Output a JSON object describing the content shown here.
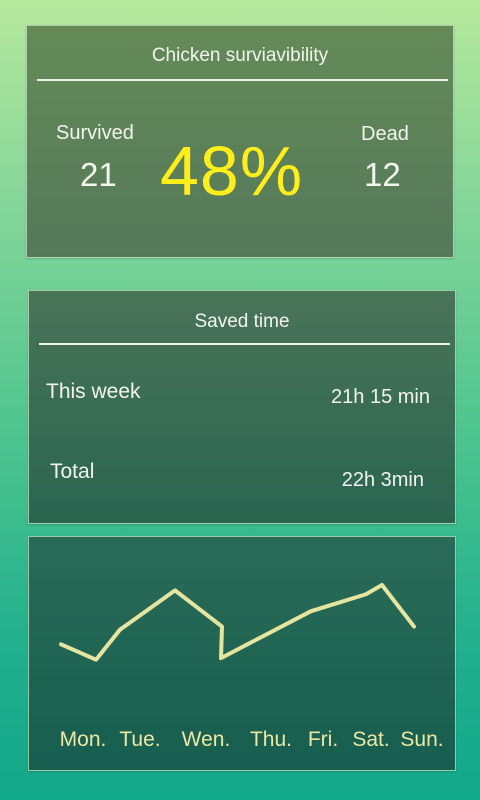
{
  "survivability": {
    "title": "Chicken surviavibility",
    "survived_label": "Survived",
    "survived_value": "21",
    "percent": "48%",
    "dead_label": "Dead",
    "dead_value": "12"
  },
  "saved_time": {
    "title": "Saved time",
    "rows": [
      {
        "label": "This week",
        "value": "21h 15 min"
      },
      {
        "label": "Total",
        "value": "22h 3min"
      }
    ]
  },
  "colors": {
    "percent": "#ffee1a",
    "line": "#e6e5a0",
    "day_labels": "#ece7a4"
  },
  "chart_data": {
    "type": "line",
    "categories": [
      "Mon.",
      "Tue.",
      "Wen.",
      "Thu.",
      "Fri.",
      "Sat.",
      "Sun."
    ],
    "points": [
      {
        "x": "Mon.",
        "y": 0.23
      },
      {
        "x": "Mon.",
        "y": 0.03
      },
      {
        "x": "Tue.",
        "y": 0.42
      },
      {
        "x": "Wen.",
        "y": 0.93
      },
      {
        "x": "Wen.",
        "y": 0.46
      },
      {
        "x": "Thu.",
        "y": 0.05
      },
      {
        "x": "Fri.",
        "y": 0.66
      },
      {
        "x": "Sat.",
        "y": 0.88
      },
      {
        "x": "Sat.",
        "y": 1.0
      },
      {
        "x": "Sun.",
        "y": 0.46
      }
    ],
    "title": "",
    "xlabel": "",
    "ylabel": "",
    "grid": false,
    "legend": "none"
  }
}
